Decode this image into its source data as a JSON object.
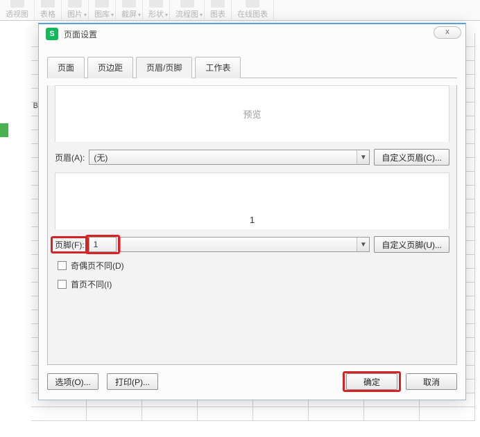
{
  "ribbon": {
    "items": [
      {
        "label": "透视图",
        "dropdown": false
      },
      {
        "label": "表格",
        "dropdown": false
      },
      {
        "label": "图片",
        "dropdown": true
      },
      {
        "label": "图库",
        "dropdown": true
      },
      {
        "label": "截屏",
        "dropdown": true
      },
      {
        "label": "形状",
        "dropdown": true
      },
      {
        "label": "流程图",
        "dropdown": true
      },
      {
        "label": "图表",
        "dropdown": false
      },
      {
        "label": "在线图表",
        "dropdown": false
      }
    ]
  },
  "grid": {
    "cols": [
      "B"
    ],
    "partial_b": "B"
  },
  "dialog": {
    "title": "页面设置",
    "close_glyph": "x",
    "tabs": [
      {
        "label": "页面"
      },
      {
        "label": "页边距"
      },
      {
        "label": "页眉/页脚",
        "active": true
      },
      {
        "label": "工作表"
      }
    ],
    "preview_label": "预览",
    "header": {
      "label": "页眉(A):",
      "value": "(无)",
      "custom_btn": "自定义页眉(C)..."
    },
    "footer_preview": "1",
    "footer": {
      "label": "页脚(F):",
      "value": "1",
      "custom_btn": "自定义页脚(U)..."
    },
    "opts": {
      "odd_even": "奇偶页不同(D)",
      "first_page": "首页不同(I)"
    },
    "buttons": {
      "options": "选项(O)...",
      "print": "打印(P)...",
      "ok": "确定",
      "cancel": "取消"
    }
  }
}
